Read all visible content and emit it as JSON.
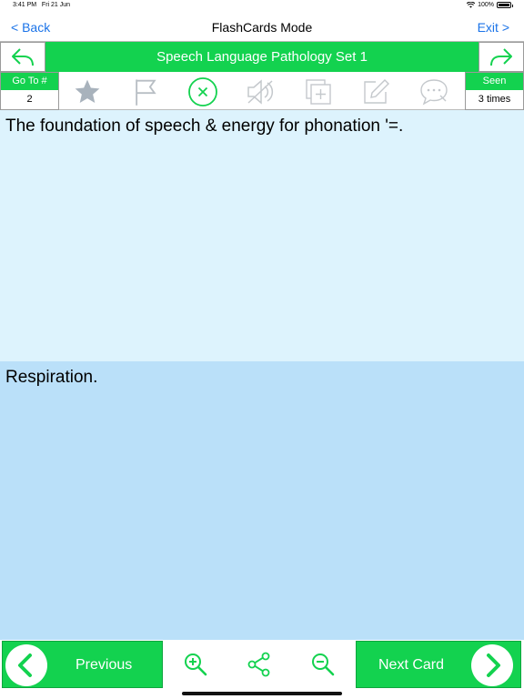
{
  "status_bar": {
    "time": "3:41 PM",
    "date": "Fri 21 Jun",
    "battery": "100%"
  },
  "nav": {
    "back_label": "< Back",
    "title": "FlashCards Mode",
    "exit_label": "Exit >"
  },
  "set": {
    "title": "Speech Language Pathology Set 1"
  },
  "goto": {
    "label": "Go To #",
    "value": "2"
  },
  "seen": {
    "label": "Seen",
    "value": "3 times"
  },
  "tools": [
    "star-icon",
    "flag-icon",
    "close-circle-icon",
    "mute-icon",
    "add-copy-icon",
    "edit-icon",
    "speech-bubble-icon"
  ],
  "card": {
    "question": "The foundation of speech & energy for phonation '=.",
    "answer": "Respiration."
  },
  "bottom": {
    "previous_label": "Previous",
    "next_label": "Next Card"
  },
  "colors": {
    "accent": "#13d24f",
    "link": "#1a73e8",
    "question_bg": "#ddf3fd",
    "answer_bg": "#bae0f9"
  }
}
